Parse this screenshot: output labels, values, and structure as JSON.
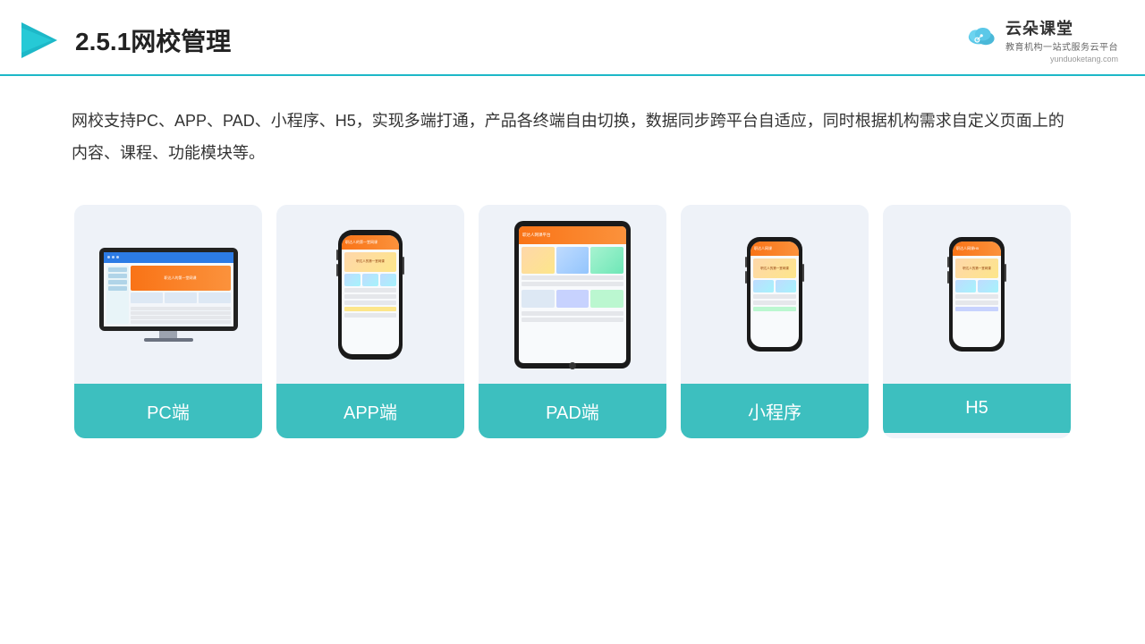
{
  "header": {
    "title": "2.5.1网校管理",
    "brand_name": "云朵课堂",
    "brand_tagline": "教育机构一站式服务云平台",
    "brand_url": "yunduoketang.com"
  },
  "description": {
    "text": "网校支持PC、APP、PAD、小程序、H5，实现多端打通，产品各终端自由切换，数据同步跨平台自适应，同时根据机构需求自定义页面上的内容、课程、功能模块等。"
  },
  "cards": [
    {
      "id": "pc",
      "label": "PC端"
    },
    {
      "id": "app",
      "label": "APP端"
    },
    {
      "id": "pad",
      "label": "PAD端"
    },
    {
      "id": "mini-program",
      "label": "小程序"
    },
    {
      "id": "h5",
      "label": "H5"
    }
  ],
  "colors": {
    "accent": "#3dbfbf",
    "header_border": "#1db8c8",
    "card_bg": "#eef2f8"
  }
}
